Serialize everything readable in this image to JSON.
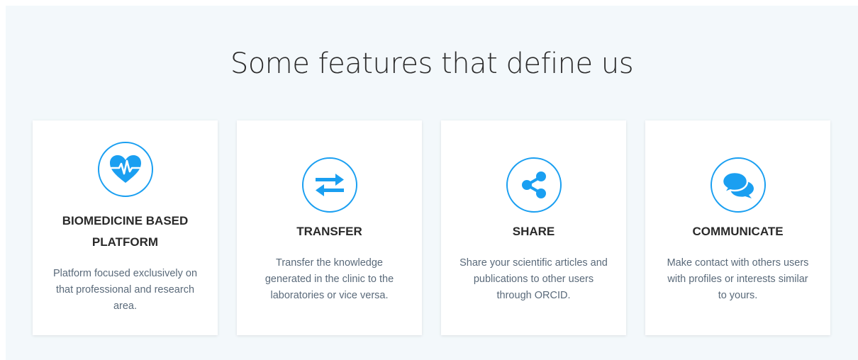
{
  "section": {
    "title": "Some features that define us"
  },
  "features": [
    {
      "icon": "heartbeat-icon",
      "title": "BIOMEDICINE BASED PLATFORM",
      "text": "Platform focused exclusively on that professional and research area."
    },
    {
      "icon": "transfer-arrows-icon",
      "title": "TRANSFER",
      "text": "Transfer the knowledge generated in the clinic to the laboratories or vice versa."
    },
    {
      "icon": "share-icon",
      "title": "SHARE",
      "text": "Share your scientific articles and publications to other users through ORCID."
    },
    {
      "icon": "chat-bubbles-icon",
      "title": "COMMUNICATE",
      "text": "Make contact with others users with profiles or interests similar to yours."
    }
  ],
  "colors": {
    "accent": "#1a9ff1",
    "section_background": "#f3f8fb",
    "card_background": "#ffffff",
    "title_text": "#2b2b2b",
    "body_text": "#5a6a7a"
  }
}
